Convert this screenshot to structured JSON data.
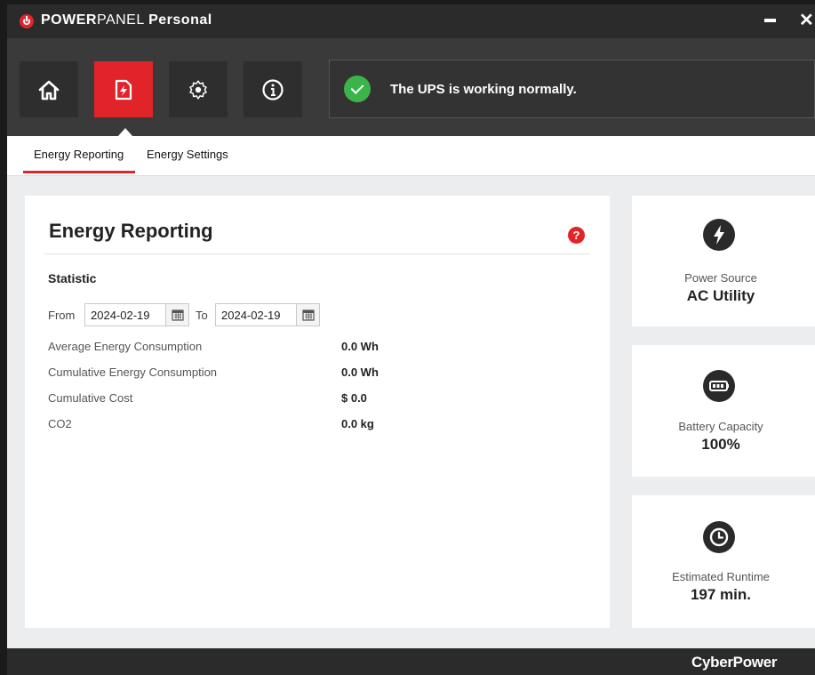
{
  "app": {
    "title_part1": "POWER",
    "title_part2": "PANEL",
    "title_part3": "Personal",
    "minimize_label": "",
    "close_label": "✕"
  },
  "toolbar": {
    "nav": [
      {
        "icon": "home-icon"
      },
      {
        "icon": "energy-report-icon",
        "active": true
      },
      {
        "icon": "settings-gear-icon"
      },
      {
        "icon": "info-icon"
      }
    ],
    "status_text": "The UPS is working normally."
  },
  "tabs": [
    "Energy Reporting",
    "Energy Settings"
  ],
  "panel": {
    "title": "Energy Reporting",
    "help": "?",
    "section": "Statistic",
    "from_label": "From",
    "from_date": "2024-02-19",
    "to_label": "To",
    "to_date": "2024-02-19",
    "rows": [
      {
        "label": "Average Energy Consumption",
        "value": "0.0 Wh"
      },
      {
        "label": "Cumulative Energy Consumption",
        "value": "0.0 Wh"
      },
      {
        "label": "Cumulative Cost",
        "value": "$ 0.0"
      },
      {
        "label": "CO2",
        "value": "0.0 kg"
      }
    ]
  },
  "cards": [
    {
      "icon": "lightning-icon",
      "label": "Power Source",
      "value": "AC Utility"
    },
    {
      "icon": "battery-icon",
      "label": "Battery Capacity",
      "value": "100%"
    },
    {
      "icon": "clock-icon",
      "label": "Estimated Runtime",
      "value": "197 min."
    }
  ],
  "footer": {
    "brand": "CyberPower"
  },
  "colors": {
    "accent": "#e1242a",
    "dark": "#2b2b2b",
    "ok": "#3bb54a"
  }
}
